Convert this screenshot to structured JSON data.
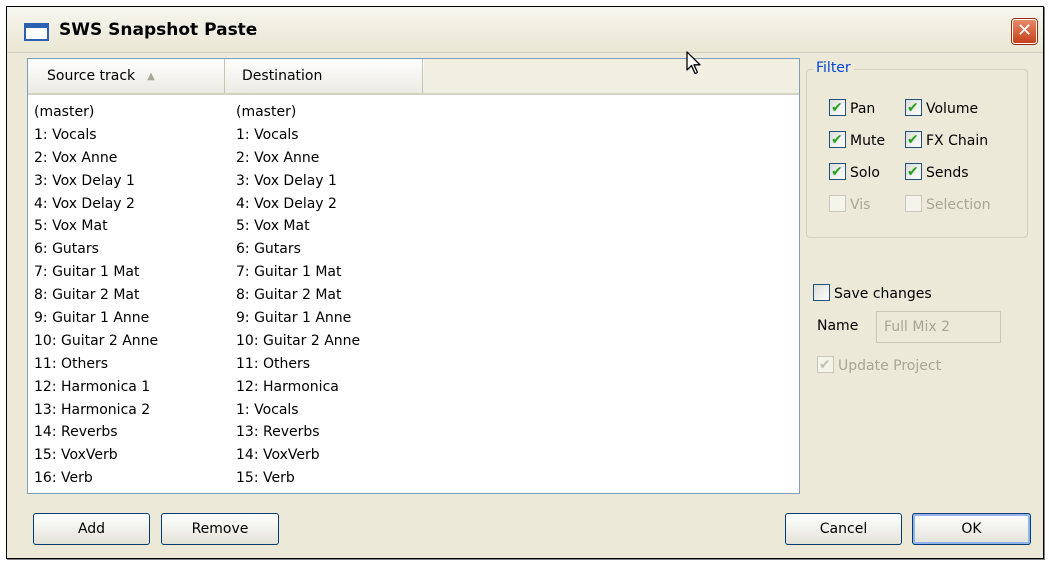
{
  "window": {
    "title": "SWS Snapshot Paste",
    "close_icon": "close-icon"
  },
  "table": {
    "columns": [
      "Source track",
      "Destination"
    ],
    "sort_column": "Source track",
    "sort_direction": "ascending",
    "rows": [
      {
        "source": "(master)",
        "destination": "(master)"
      },
      {
        "source": "1: Vocals",
        "destination": "1: Vocals"
      },
      {
        "source": "2: Vox Anne",
        "destination": "2: Vox Anne"
      },
      {
        "source": "3: Vox Delay 1",
        "destination": "3: Vox Delay 1"
      },
      {
        "source": "4: Vox Delay 2",
        "destination": "4: Vox Delay 2"
      },
      {
        "source": "5: Vox Mat",
        "destination": "5: Vox Mat"
      },
      {
        "source": "6: Gutars",
        "destination": "6: Gutars"
      },
      {
        "source": "7: Guitar 1 Mat",
        "destination": "7: Guitar 1 Mat"
      },
      {
        "source": "8: Guitar 2 Mat",
        "destination": "8: Guitar 2 Mat"
      },
      {
        "source": "9: Guitar 1 Anne",
        "destination": "9: Guitar 1 Anne"
      },
      {
        "source": "10: Guitar 2 Anne",
        "destination": "10: Guitar 2 Anne"
      },
      {
        "source": "11: Others",
        "destination": "11: Others"
      },
      {
        "source": "12: Harmonica 1",
        "destination": "12: Harmonica"
      },
      {
        "source": "13: Harmonica 2",
        "destination": "1: Vocals"
      },
      {
        "source": "14: Reverbs",
        "destination": "13: Reverbs"
      },
      {
        "source": "15: VoxVerb",
        "destination": "14: VoxVerb"
      },
      {
        "source": "16: Verb",
        "destination": "15: Verb"
      }
    ]
  },
  "filter": {
    "legend": "Filter",
    "pan": {
      "label": "Pan",
      "checked": true
    },
    "volume": {
      "label": "Volume",
      "checked": true
    },
    "mute": {
      "label": "Mute",
      "checked": true
    },
    "fx_chain": {
      "label": "FX Chain",
      "checked": true
    },
    "solo": {
      "label": "Solo",
      "checked": true
    },
    "sends": {
      "label": "Sends",
      "checked": true
    },
    "vis": {
      "label": "Vis",
      "checked": false,
      "disabled": true
    },
    "selection": {
      "label": "Selection",
      "checked": false,
      "disabled": true
    }
  },
  "save": {
    "save_changes_label": "Save changes",
    "save_changes_checked": false,
    "name_label": "Name",
    "name_value": "Full Mix 2",
    "update_project_label": "Update Project",
    "update_project_checked": true
  },
  "buttons": {
    "add": "Add",
    "remove": "Remove",
    "cancel": "Cancel",
    "ok": "OK"
  },
  "colors": {
    "accent": "#0046d5",
    "close_button": "#c5411a",
    "window_bg": "#ece9d8"
  }
}
